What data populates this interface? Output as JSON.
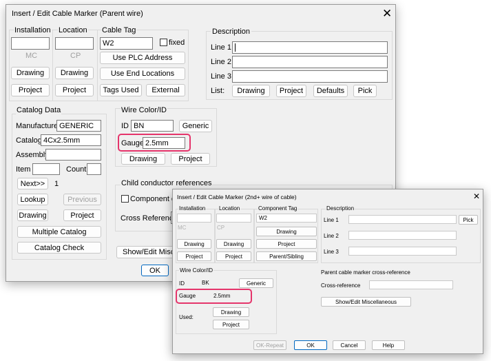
{
  "parent": {
    "title": "Insert / Edit Cable Marker (Parent wire)",
    "installation": {
      "label": "Installation",
      "value": "",
      "ghost": "MC",
      "drawing": "Drawing",
      "project": "Project"
    },
    "location": {
      "label": "Location",
      "value": "",
      "ghost": "CP",
      "drawing": "Drawing",
      "project": "Project"
    },
    "cable_tag": {
      "label": "Cable Tag",
      "value": "W2",
      "fixed_label": "fixed",
      "fixed_checked": false,
      "use_plc": "Use PLC Address",
      "use_end": "Use End Locations",
      "tags_used": "Tags Used",
      "external": "External"
    },
    "description": {
      "label": "Description",
      "line1": "Line 1",
      "line2": "Line 2",
      "line3": "Line 3",
      "line1_value": "",
      "line2_value": "",
      "line3_value": "",
      "list_label": "List:",
      "drawing": "Drawing",
      "project": "Project",
      "defaults": "Defaults",
      "pick": "Pick"
    },
    "catalog": {
      "label": "Catalog Data",
      "manufacturer_label": "Manufacturer",
      "manufacturer": "GENERIC",
      "catalog_label": "Catalog",
      "catalog": "4Cx2.5mm",
      "assembly_label": "Assembly",
      "assembly": "",
      "item_label": "Item",
      "item": "",
      "count_label": "Count",
      "count": "",
      "next": "Next>>",
      "next_num": "1",
      "lookup": "Lookup",
      "previous": "Previous",
      "drawing": "Drawing",
      "project": "Project",
      "multiple": "Multiple Catalog",
      "check": "Catalog Check"
    },
    "wire_color": {
      "label": "Wire Color/ID",
      "id_label": "ID",
      "id_value": "BN",
      "generic": "Generic",
      "gauge_label": "Gauge",
      "gauge_value": "2.5mm",
      "drawing": "Drawing",
      "project": "Project"
    },
    "child": {
      "label": "Child conductor references",
      "component_over": "Component ove",
      "cross_reference": "Cross Reference",
      "show_edit": "Show/Edit Miscella"
    },
    "ok": "OK"
  },
  "child": {
    "title": "Insert / Edit Cable Marker (2nd+ wire of cable)",
    "installation": {
      "label": "Installation",
      "value": "",
      "ghost": "MC",
      "drawing": "Drawing",
      "project": "Project"
    },
    "location": {
      "label": "Location",
      "value": "",
      "ghost": "CP",
      "drawing": "Drawing",
      "project": "Project"
    },
    "component_tag": {
      "label": "Component Tag",
      "value": "W2",
      "drawing": "Drawing",
      "project": "Project",
      "parent_sibling": "Parent/Sibling"
    },
    "description": {
      "label": "Description",
      "line1": "Line 1",
      "line2": "Line 2",
      "line3": "Line 3",
      "line1_value": "",
      "line2_value": "",
      "line3_value": "",
      "pick": "Pick"
    },
    "wire_color": {
      "label": "Wire Color/ID",
      "id_label": "ID",
      "id_value": "BK",
      "generic": "Generic",
      "gauge_label": "Gauge",
      "gauge_value": "2.5mm",
      "drawing": "Drawing",
      "project": "Project",
      "used_label": "Used:"
    },
    "parent_xref": {
      "label": "Parent cable marker cross-reference",
      "xref_label": "Cross-reference",
      "xref_value": "",
      "show_edit": "Show/Edit Miscellaneous"
    },
    "ok_repeat": "OK-Repeat",
    "ok": "OK",
    "cancel": "Cancel",
    "help": "Help"
  },
  "colors": {
    "highlight": "#e5346b",
    "dialog_bg": "#f0f0f0",
    "default_button_border": "#0067c0"
  },
  "icons": {
    "close": "close-icon",
    "checkbox": "checkbox-icon"
  }
}
